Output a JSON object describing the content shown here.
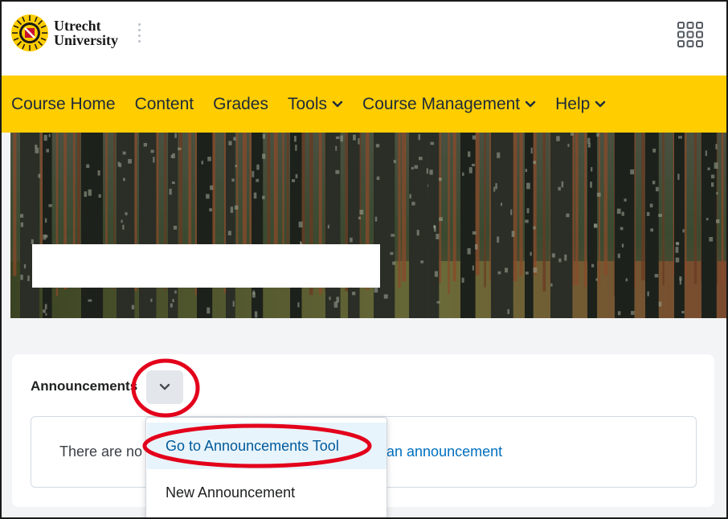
{
  "header": {
    "logo_line1": "Utrecht",
    "logo_line2": "University"
  },
  "nav": {
    "items": [
      {
        "label": "Course Home",
        "has_dropdown": false
      },
      {
        "label": "Content",
        "has_dropdown": false
      },
      {
        "label": "Grades",
        "has_dropdown": false
      },
      {
        "label": "Tools",
        "has_dropdown": true
      },
      {
        "label": "Course Management",
        "has_dropdown": true
      },
      {
        "label": "Help",
        "has_dropdown": true
      }
    ]
  },
  "widget": {
    "title": "Announcements",
    "empty_text": "There are no",
    "empty_link": "an announcement"
  },
  "dropdown": {
    "items": [
      {
        "label": "Go to Announcements Tool",
        "highlighted": true
      },
      {
        "label": "New Announcement",
        "highlighted": false
      }
    ]
  },
  "colors": {
    "brand_yellow": "#ffcd00",
    "link_blue": "#006fbf",
    "annotation_red": "#e3001b"
  }
}
